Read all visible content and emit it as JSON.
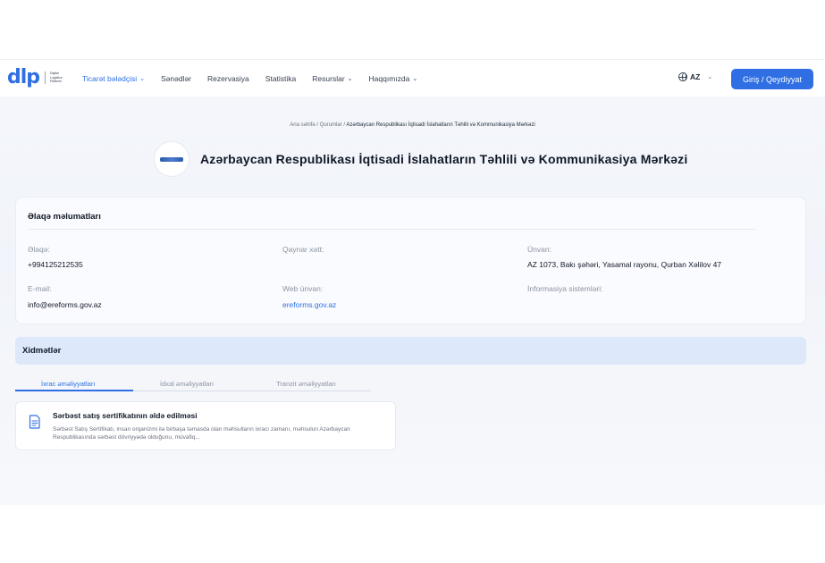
{
  "header": {
    "logo_mark": "dlp",
    "logo_text": "Digital Logistics Platform",
    "nav": [
      {
        "label": "Ticarət bələdçisi",
        "dropdown": true,
        "active": true
      },
      {
        "label": "Sənədlər",
        "dropdown": false
      },
      {
        "label": "Rezervasiya",
        "dropdown": false
      },
      {
        "label": "Statistika",
        "dropdown": false
      },
      {
        "label": "Resurslar",
        "dropdown": true
      },
      {
        "label": "Haqqımızda",
        "dropdown": true
      }
    ],
    "language": "AZ",
    "login_label": "Giriş / Qeydiyyat"
  },
  "breadcrumb": {
    "home": "Ana səhifə",
    "section": "Qurumlar",
    "current": "Azərbaycan Respublikası İqtisadi İslahatların Təhlili və Kommunikasiya Mərkəzi",
    "separator": " / "
  },
  "page_title": "Azərbaycan Respublikası İqtisadi İslahatların Təhlili və Kommunikasiya Mərkəzi",
  "contact": {
    "title": "Əlaqə məlumatları",
    "contact_label": "Əlaqə:",
    "contact_value": "+994125212535",
    "hotline_label": "Qaynar xətt:",
    "address_label": "Ünvan:",
    "address_value": "AZ 1073, Bakı şəhəri, Yasamal rayonu, Qurban Xəlilov 47",
    "email_label": "E-mail:",
    "email_value": "info@ereforms.gov.az",
    "web_label": "Web ünvan:",
    "web_value": "ereforms.gov.az",
    "info_systems_label": "İnformasiya sistemləri:"
  },
  "services": {
    "title": "Xidmətlər",
    "tabs": [
      "İxrac əməliyyatları",
      "İdxal əməliyyatları",
      "Tranzit əməliyyatları"
    ],
    "active_tab": 0,
    "items": [
      {
        "title": "Sərbəst satış sertifikatının əldə edilməsi",
        "description": "Sərbəst Satış Sertifikatı, insan orqanizmi ilə birbaşa təmasda olan məhsulların ixracı zamanı, məhsulun Azərbaycan Respublikasında sərbəst dövriyyədə olduğunu, müvafiq..."
      }
    ]
  },
  "colors": {
    "accent": "#2f6fe3",
    "services_bar": "#dde8fb"
  }
}
